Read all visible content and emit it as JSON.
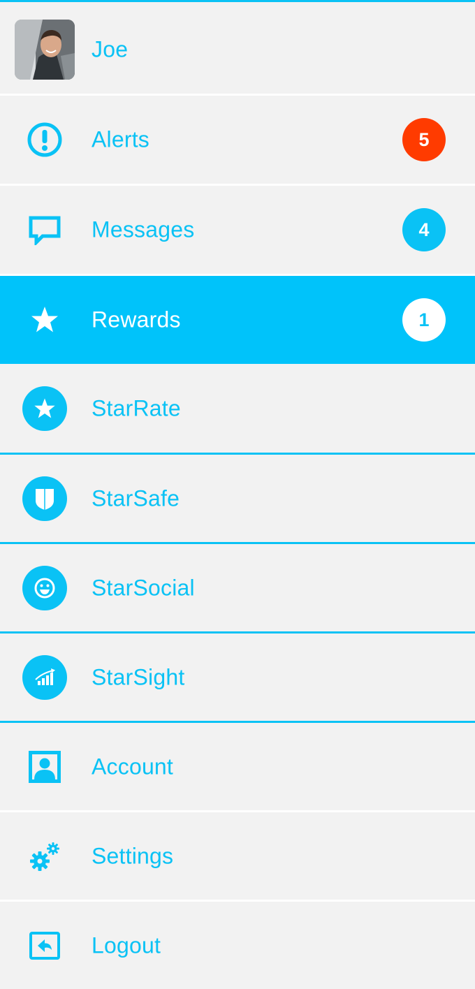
{
  "user": {
    "name": "Joe"
  },
  "menu": [
    {
      "id": "alerts",
      "label": "Alerts",
      "icon": "alert-icon",
      "badge": "5"
    },
    {
      "id": "messages",
      "label": "Messages",
      "icon": "message-icon",
      "badge": "4"
    },
    {
      "id": "rewards",
      "label": "Rewards",
      "icon": "star-icon",
      "badge": "1",
      "active": true
    },
    {
      "id": "starrate",
      "label": "StarRate",
      "icon": "star-circle-icon"
    },
    {
      "id": "starsafe",
      "label": "StarSafe",
      "icon": "shield-icon"
    },
    {
      "id": "starsocial",
      "label": "StarSocial",
      "icon": "smiley-icon"
    },
    {
      "id": "starsight",
      "label": "StarSight",
      "icon": "chart-icon"
    },
    {
      "id": "account",
      "label": "Account",
      "icon": "account-icon"
    },
    {
      "id": "settings",
      "label": "Settings",
      "icon": "gears-icon"
    },
    {
      "id": "logout",
      "label": "Logout",
      "icon": "logout-icon"
    }
  ],
  "colors": {
    "accent": "#0ac2f5",
    "active_bg": "#00c3fa",
    "alert_badge": "#ff3b00",
    "background": "#f2f2f2"
  }
}
